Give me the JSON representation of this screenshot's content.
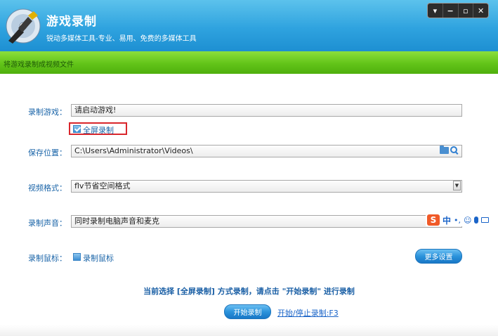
{
  "app": {
    "title": "游戏录制",
    "subtitle": "锐动多媒体工具-专业、易用、免费的多媒体工具"
  },
  "window_controls": {
    "menu": "▾",
    "minimize": "−",
    "maximize": "▫",
    "close": "✕"
  },
  "banner": {
    "text": "将游戏录制成视频文件"
  },
  "form": {
    "game": {
      "label": "录制游戏：",
      "value": "请启动游戏!"
    },
    "fullscreen": {
      "label": "全屏录制",
      "checked": true
    },
    "save_location": {
      "label": "保存位置：",
      "value": "C:\\Users\\Administrator\\Videos\\"
    },
    "video_format": {
      "label": "视频格式：",
      "value": "flv节省空间格式"
    },
    "audio": {
      "label": "录制声音：",
      "value": "同时录制电脑声音和麦克"
    },
    "mouse": {
      "label": "录制鼠标：",
      "checkbox_label": "录制鼠标",
      "checked": false
    }
  },
  "ime": {
    "logo": "S",
    "mode": "中",
    "punct": "•,",
    "emoji": "☺"
  },
  "buttons": {
    "more_settings": "更多设置",
    "start_record": "开始录制"
  },
  "hint": "当前选择 [全屏录制] 方式录制，请点击 \"开始录制\" 进行录制",
  "hotkey": "开始/停止录制:F3",
  "colors": {
    "header_blue": "#2fa3df",
    "banner_green": "#62c419",
    "label_blue": "#1a64a8",
    "highlight_red": "#d9262c"
  }
}
